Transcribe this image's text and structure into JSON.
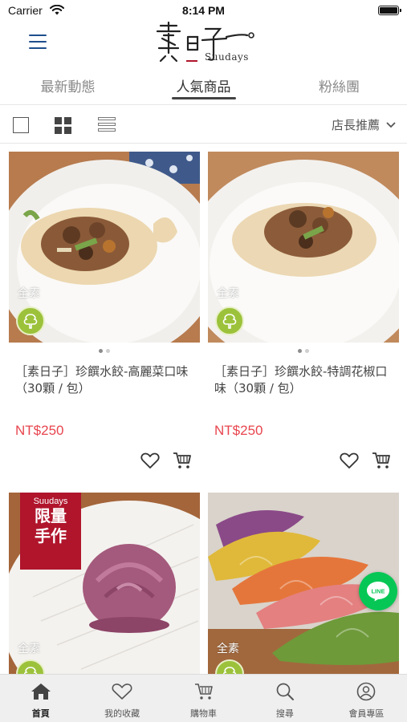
{
  "status_bar": {
    "carrier": "Carrier",
    "time": "8:14 PM"
  },
  "header": {
    "logo_text": "Suudays"
  },
  "tabs": [
    {
      "label": "最新動態",
      "active": false
    },
    {
      "label": "人氣商品",
      "active": true
    },
    {
      "label": "粉絲團",
      "active": false
    }
  ],
  "toolbar": {
    "sort_label": "店長推薦"
  },
  "products": [
    {
      "badge": "全素",
      "name": "［素日子］珍饌水餃-高麗菜口味（30顆 / 包）",
      "price": "NT$250"
    },
    {
      "badge": "全素",
      "name": "［素日子］珍饌水餃-特調花椒口味（30顆 / 包）",
      "price": "NT$250"
    },
    {
      "badge": "全素",
      "tag_small": "Suudays",
      "tag_large_1": "限量",
      "tag_large_2": "手作"
    },
    {
      "badge": "全素"
    }
  ],
  "line_fab": {
    "label": "LINE"
  },
  "bottom_nav": [
    {
      "label": "首頁",
      "icon": "home-icon",
      "active": true
    },
    {
      "label": "我的收藏",
      "icon": "heart-icon",
      "active": false
    },
    {
      "label": "購物車",
      "icon": "cart-icon",
      "active": false
    },
    {
      "label": "搜尋",
      "icon": "search-icon",
      "active": false
    },
    {
      "label": "會員專區",
      "icon": "user-icon",
      "active": false
    }
  ],
  "colors": {
    "price": "#e8454e",
    "badge_green": "#9cc23b",
    "limited_red": "#b0152c",
    "line_green": "#06c755",
    "menu_blue": "#1f4e8c"
  }
}
